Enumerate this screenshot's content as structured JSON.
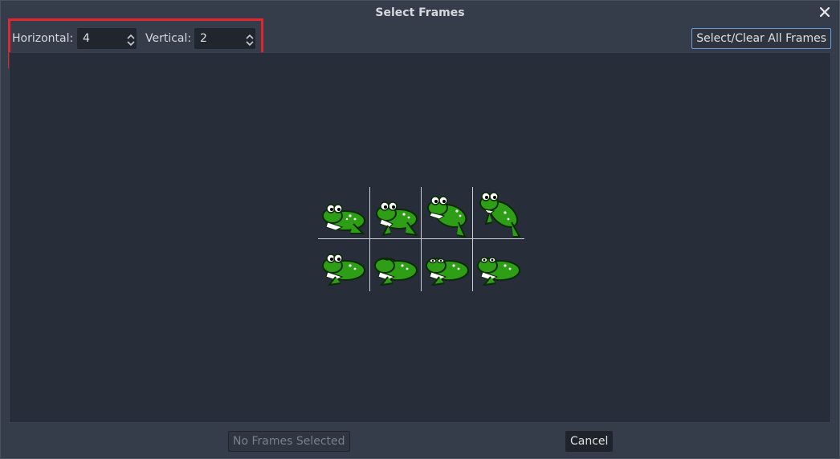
{
  "dialog": {
    "title": "Select Frames",
    "close_icon": "close-icon"
  },
  "toolbar": {
    "horizontal_label": "Horizontal:",
    "horizontal_value": "4",
    "vertical_label": "Vertical:",
    "vertical_value": "2",
    "select_clear_label": "Select/Clear All Frames"
  },
  "frames": {
    "columns": 4,
    "rows": 2,
    "sprite": "frog-sprite",
    "sprite_colors": {
      "body": "#2f9e17",
      "outline": "#0b2a06",
      "spots": "#ffffff"
    }
  },
  "footer": {
    "no_frames_label": "No Frames Selected",
    "cancel_label": "Cancel"
  },
  "colors": {
    "dialog_bg": "#363d4a",
    "view_bg": "#272d39",
    "highlight": "#e0262e",
    "accent_border": "#6b9cda"
  }
}
